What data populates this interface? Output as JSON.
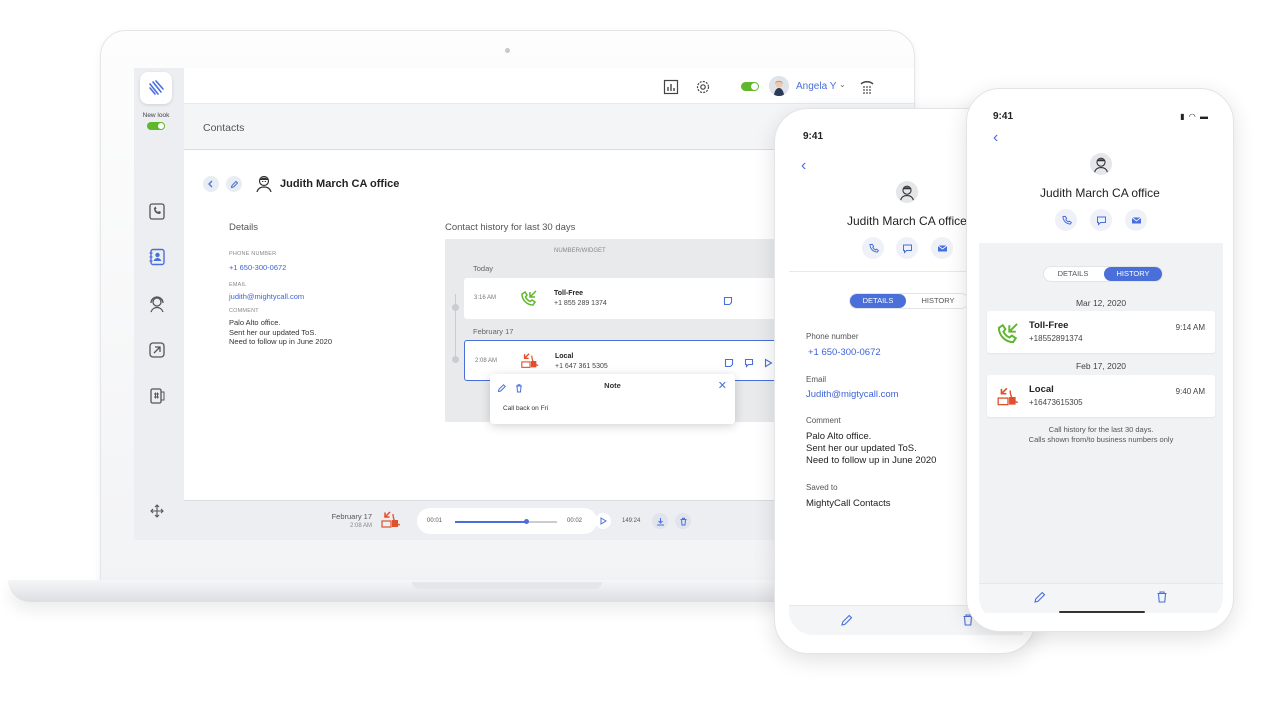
{
  "sidebar": {
    "new_look_label": "New look"
  },
  "topbar": {
    "user_name": "Angela Y"
  },
  "breadcrumb": {
    "title": "Contacts"
  },
  "contact": {
    "name": "Judith March CA office",
    "details_heading": "Details",
    "phone_label": "PHONE NUMBER",
    "phone": "+1 650-300-0672",
    "email_label": "EMAIL",
    "email": "judith@mightycall.com",
    "comment_label": "COMMENT",
    "comment_lines": [
      "Palo Alto office.",
      "Sent her our updated ToS.",
      "Need to follow up in June 2020"
    ]
  },
  "history": {
    "heading": "Contact history for last 30 days",
    "column_header": "NUMBER/WIDGET",
    "groups": [
      {
        "day": "Today",
        "time": "3:16 AM",
        "type": "Toll-Free",
        "number": "+1 855 289 1374"
      },
      {
        "day": "February 17",
        "time": "2:08 AM",
        "type": "Local",
        "number": "+1 647 361 5305"
      }
    ]
  },
  "note": {
    "title": "Note",
    "text": "Call back on Fri"
  },
  "player": {
    "date": "February 17",
    "time": "2:08 AM",
    "current": "00:01",
    "end": "00:02",
    "total": "149:24",
    "progress": 0.7
  },
  "phone1": {
    "status_time": "9:41",
    "name": "Judith March CA office",
    "tab_details": "DETAILS",
    "tab_history": "HISTORY",
    "phone_label": "Phone number",
    "phone": "+1  650-300-0672",
    "email_label": "Email",
    "email": "Judith@migtycall.com",
    "comment_label": "Comment",
    "comment_lines": [
      "Palo Alto office.",
      "Sent her our updated ToS.",
      "Need to follow up in June 2020"
    ],
    "saved_label": "Saved to",
    "saved_value": "MightyCall Contacts"
  },
  "phone2": {
    "status_time": "9:41",
    "name": "Judith March CA office",
    "tab_details": "DETAILS",
    "tab_history": "HISTORY",
    "entries": [
      {
        "date": "Mar 12, 2020",
        "type": "Toll-Free",
        "number": "+18552891374",
        "time": "9:14 AM"
      },
      {
        "date": "Feb 17, 2020",
        "type": "Local",
        "number": "+16473615305",
        "time": "9:40 AM"
      }
    ],
    "footnote_lines": [
      "Call history for the last 30 days.",
      "Calls shown from/to business numbers only"
    ]
  },
  "colors": {
    "accent": "#4a6fd9",
    "toggle_green": "#5fb72b",
    "incoming_green": "#5fb72b",
    "local_red": "#e0502a"
  }
}
